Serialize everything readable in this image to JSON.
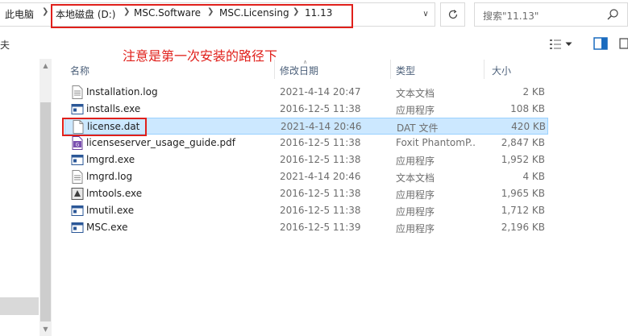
{
  "breadcrumb": {
    "items": [
      "此电脑",
      "本地磁盘 (D:)",
      "MSC.Software",
      "MSC.Licensing",
      "11.13"
    ]
  },
  "search": {
    "placeholder": "搜索\"11.13\""
  },
  "annotation": {
    "text": "注意是第一次安装的路径下",
    "color": "#e0201b"
  },
  "nav": {
    "stub_label": "夫"
  },
  "columns": {
    "name": "名称",
    "date": "修改日期",
    "type": "类型",
    "size": "大小"
  },
  "files": [
    {
      "name": "Installation.log",
      "date": "2021-4-14 20:47",
      "type": "文本文档",
      "size": "2 KB",
      "icon": "text-file-icon"
    },
    {
      "name": "installs.exe",
      "date": "2016-12-5 11:38",
      "type": "应用程序",
      "size": "108 KB",
      "icon": "exe-file-icon"
    },
    {
      "name": "license.dat",
      "date": "2021-4-14 20:46",
      "type": "DAT 文件",
      "size": "420 KB",
      "icon": "blank-file-icon",
      "selected": true
    },
    {
      "name": "licenseserver_usage_guide.pdf",
      "date": "2016-12-5 11:38",
      "type": "Foxit PhantomP...",
      "size": "2,847 KB",
      "icon": "pdf-file-icon"
    },
    {
      "name": "lmgrd.exe",
      "date": "2016-12-5 11:38",
      "type": "应用程序",
      "size": "1,952 KB",
      "icon": "exe-file-icon"
    },
    {
      "name": "lmgrd.log",
      "date": "2021-4-14 20:46",
      "type": "文本文档",
      "size": "4 KB",
      "icon": "text-file-icon"
    },
    {
      "name": "lmtools.exe",
      "date": "2016-12-5 11:38",
      "type": "应用程序",
      "size": "1,965 KB",
      "icon": "lmtools-exe-icon"
    },
    {
      "name": "lmutil.exe",
      "date": "2016-12-5 11:38",
      "type": "应用程序",
      "size": "1,712 KB",
      "icon": "exe-file-icon"
    },
    {
      "name": "MSC.exe",
      "date": "2016-12-5 11:39",
      "type": "应用程序",
      "size": "2,196 KB",
      "icon": "exe-file-icon"
    }
  ],
  "colors": {
    "selection": "#cce8ff",
    "selection_border": "#99d1ff",
    "header_text": "#4c607a"
  }
}
